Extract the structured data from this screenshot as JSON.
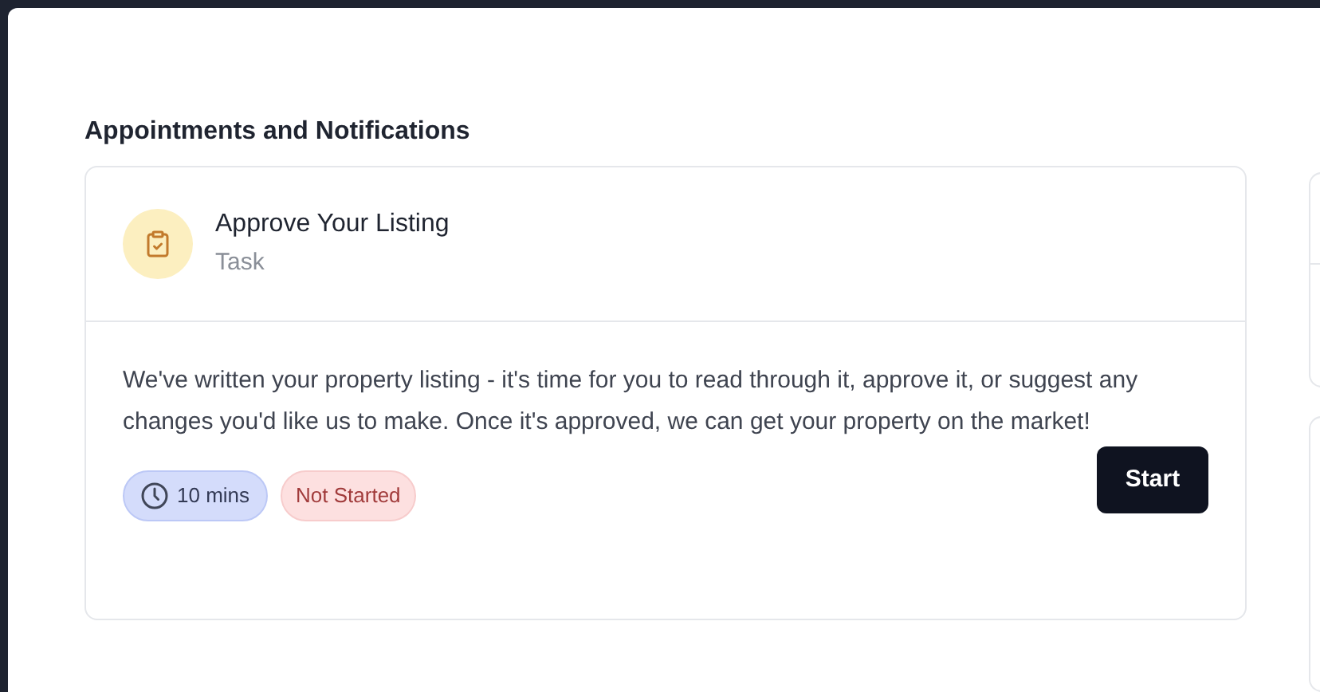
{
  "section_title": "Appointments and Notifications",
  "task": {
    "title": "Approve Your Listing",
    "type": "Task",
    "description": "We've written your property listing - it's time for you to read through it, approve it, or suggest any changes you'd like us to make. Once it's approved, we can get your property on the market!",
    "duration": "10 mins",
    "status": "Not Started",
    "action": "Start"
  }
}
